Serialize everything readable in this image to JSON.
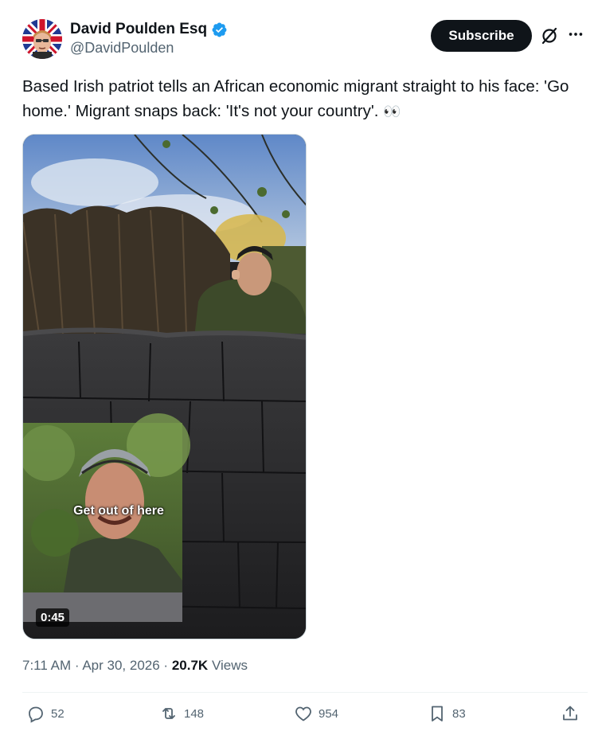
{
  "author": {
    "display_name": "David Poulden Esq",
    "handle": "@DavidPoulden",
    "avatar_icon": "union-jack-avatar",
    "verified": true
  },
  "header": {
    "subscribe_label": "Subscribe"
  },
  "tweet": {
    "text": "Based Irish patriot tells an African economic migrant straight to his face: 'Go home.' Migrant snaps back: 'It's not your country'.",
    "emoji": "👀"
  },
  "media": {
    "caption": "Get out of here",
    "duration": "0:45"
  },
  "meta": {
    "time": "7:11 AM",
    "separator": "·",
    "date": "Apr 30, 2026",
    "views_count": "20.7K",
    "views_label": "Views"
  },
  "actions": {
    "replies": "52",
    "reposts": "148",
    "likes": "954",
    "bookmarks": "83"
  },
  "colors": {
    "text_primary": "#0f1419",
    "text_secondary": "#536471",
    "verified_blue": "#1d9bf0",
    "subscribe_bg": "#0f1419"
  }
}
